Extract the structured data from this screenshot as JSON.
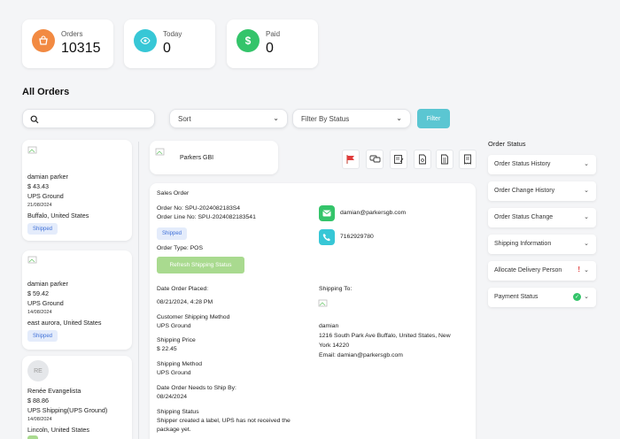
{
  "stats": [
    {
      "label": "Orders",
      "value": "10315",
      "color": "#f28a42",
      "icon": "basket-icon"
    },
    {
      "label": "Today",
      "value": "0",
      "color": "#37c7d6",
      "icon": "eye-icon"
    },
    {
      "label": "Paid",
      "value": "0",
      "color": "#34c46a",
      "icon": "dollar-icon"
    }
  ],
  "page_title": "All Orders",
  "filters": {
    "search_placeholder": "",
    "sort_label": "Sort",
    "status_label": "Filter By Status",
    "filter_button": "Filter"
  },
  "orders": [
    {
      "name": "damian parker",
      "amount": "$ 43.43",
      "shipping": "UPS Ground",
      "date": "21/08/2024",
      "location": "Buffalo, United States",
      "status": "Shipped"
    },
    {
      "name": "damian parker",
      "amount": "$ 59.42",
      "shipping": "UPS Ground",
      "date": "14/08/2024",
      "location": "east aurora, United States",
      "status": "Shipped"
    },
    {
      "name": "Renée Evangelista",
      "avatar": "RE",
      "amount": "$ 88.86",
      "shipping": "UPS Shipping(UPS Ground)",
      "date": "14/08/2024",
      "location": "Lincoln, United States"
    }
  ],
  "customer": {
    "name": "Parkers GBI"
  },
  "detail": {
    "heading": "Sales Order",
    "order_no": "Order No: SPU-2024082183S4",
    "order_line": "Order Line No: SPU-2024082183541",
    "status": "Shipped",
    "order_type": "Order Type: POS",
    "refresh_button": "Refresh Shipping Status",
    "email": "damian@parkersgb.com",
    "phone": "7162929780",
    "date_placed_label": "Date Order Placed:",
    "date_placed": "08/21/2024, 4:28 PM",
    "cust_method_label": "Customer Shipping Method",
    "cust_method": "UPS Ground",
    "ship_price_label": "Shipping Price",
    "ship_price": "$ 22.45",
    "ship_method_label": "Shipping Method",
    "ship_method": "UPS Ground",
    "ship_by_label": "Date Order Needs to Ship By:",
    "ship_by": "08/24/2024",
    "ship_status_label": "Shipping Status",
    "ship_status_1": "Shipper created a label, UPS has not received the",
    "ship_status_2": "package yet.",
    "ship_to_label": "Shipping To:",
    "ship_to_name": "damian",
    "ship_to_addr1": "1216 South Park Ave Buffalo, United States, New",
    "ship_to_addr2": "York 14220",
    "ship_to_email": "Email: damian@parkersgb.com"
  },
  "status_panel": {
    "title": "Order Status",
    "items": [
      {
        "label": "Order Status History"
      },
      {
        "label": "Order Change History"
      },
      {
        "label": "Order Status Change"
      },
      {
        "label": "Shipping Information"
      },
      {
        "label": "Allocate Delivery Person",
        "indicator": "!"
      },
      {
        "label": "Payment Status",
        "indicator": "✓"
      }
    ]
  }
}
